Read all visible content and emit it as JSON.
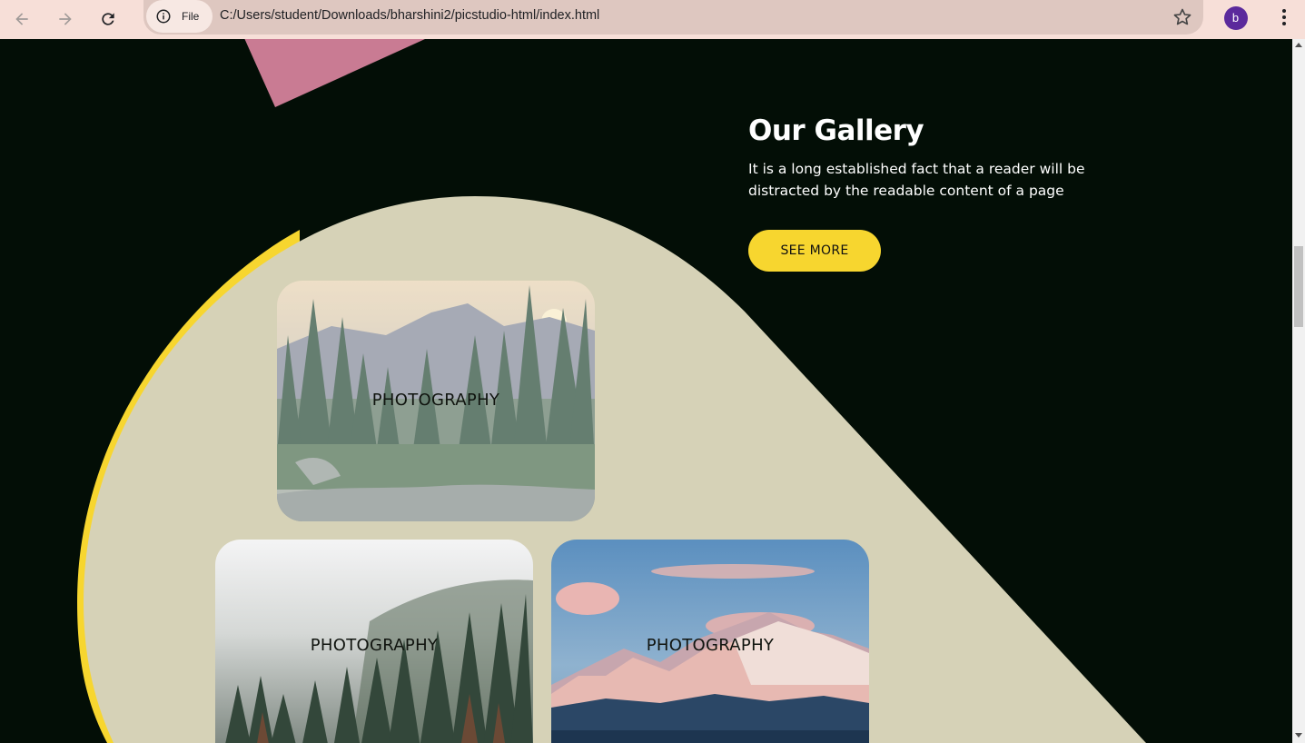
{
  "browser": {
    "url": "C:/Users/student/Downloads/bharshini2/picstudio-html/index.html",
    "site_info_label": "File",
    "profile_initial": "b"
  },
  "gallery": {
    "title": "Our Gallery",
    "description": "It is a long established fact that a reader will be distracted by the readable content of a page",
    "button_label": "SEE MORE",
    "cards": [
      {
        "label": "PHOTOGRAPHY",
        "image": "forest-mountain-sunset"
      },
      {
        "label": "PHOTOGRAPHY",
        "image": "misty-forest"
      },
      {
        "label": "PHOTOGRAPHY",
        "image": "snowy-mountains-sky"
      }
    ]
  },
  "colors": {
    "page_bg": "#030e06",
    "accent_yellow": "#f7d62f",
    "blob_beige": "#d6d2b7",
    "pink_shape": "#c97b93",
    "chrome_bg": "#f7dfd8"
  }
}
